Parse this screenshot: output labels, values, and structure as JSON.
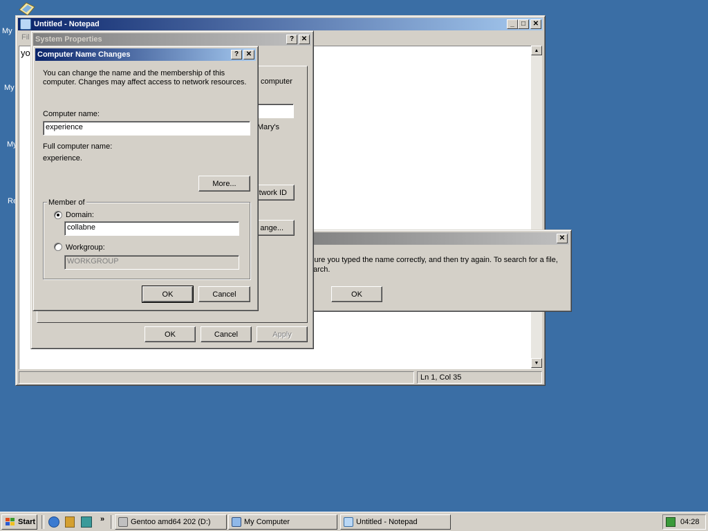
{
  "desktop": {
    "icons": [
      "My",
      "My",
      "My",
      "Re"
    ]
  },
  "notepad": {
    "title": "Untitled - Notepad",
    "menu_stub": "Fil",
    "text": "yo",
    "status_position": "Ln 1, Col 35",
    "buttons": {
      "minimize": "_",
      "maximize": "□",
      "close": "✕"
    }
  },
  "system_properties": {
    "title": "System Properties",
    "help": "?",
    "close": "✕",
    "partial_text_1": "computer",
    "partial_text_2": "Mary's",
    "network_id_button": "twork ID",
    "change_button": "ange...",
    "ok": "OK",
    "cancel": "Cancel",
    "apply": "Apply"
  },
  "error_dialog": {
    "close": "✕",
    "message_line1": "sure you typed the name correctly, and then try again. To search for a file,",
    "message_line2": "arch.",
    "ok": "OK"
  },
  "name_changes": {
    "title": "Computer Name Changes",
    "help": "?",
    "close": "✕",
    "intro_line1": "You can change the name and the membership of this",
    "intro_line2": "computer. Changes may affect access to network resources.",
    "computer_name_label": "Computer name:",
    "computer_name_value": "experience",
    "full_name_label": "Full computer name:",
    "full_name_value": "experience.",
    "more_button": "More...",
    "member_of_label": "Member of",
    "domain_label": "Domain:",
    "domain_value": "collabne",
    "workgroup_label": "Workgroup:",
    "workgroup_value": "WORKGROUP",
    "ok": "OK",
    "cancel": "Cancel"
  },
  "taskbar": {
    "start": "Start",
    "chevron": "»",
    "tasks": [
      "Gentoo amd64 202 (D:)",
      "My Computer",
      "Untitled - Notepad"
    ],
    "clock": "04:28"
  },
  "colors": {
    "desktop": "#3a6ea5",
    "title_active": "#0a246a",
    "face": "#d4d0c8"
  }
}
